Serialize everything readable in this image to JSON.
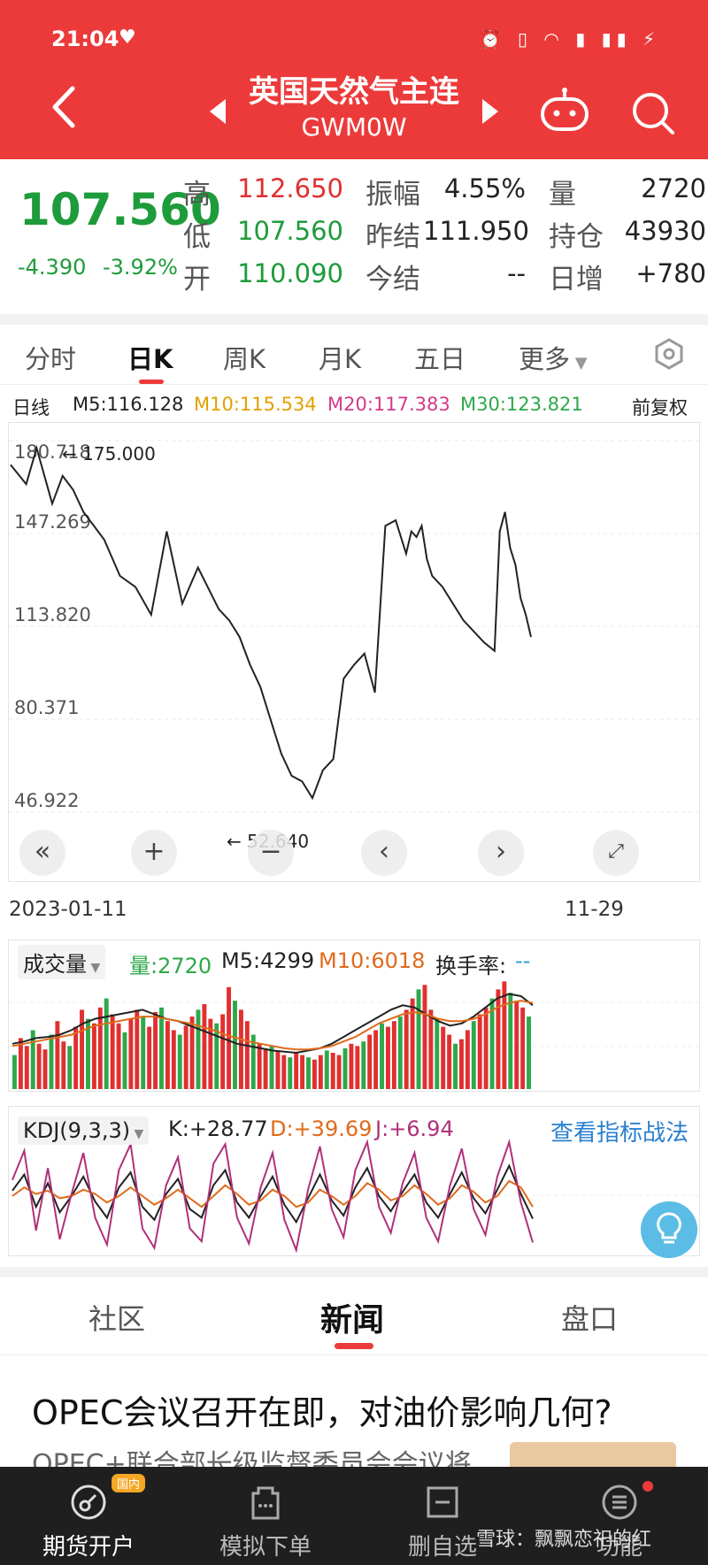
{
  "status_bar": {
    "time": "21:04"
  },
  "header": {
    "title": "英国天然气主连",
    "code": "GWM0W"
  },
  "quote": {
    "last_price": "107.560",
    "change": "-4.390",
    "change_pct": "-3.92%",
    "high_label": "高",
    "high": "112.650",
    "low_label": "低",
    "low": "107.560",
    "open_label": "开",
    "open": "110.090",
    "amplitude_label": "振幅",
    "amplitude": "4.55%",
    "prev_settle_label": "昨结",
    "prev_settle": "111.950",
    "settle_label": "今结",
    "settle": "--",
    "volume_label": "量",
    "volume": "2720",
    "open_interest_label": "持仓",
    "open_interest": "43930",
    "daily_change_label": "日增",
    "daily_change": "+780",
    "colors": {
      "up": "#e03030",
      "down": "#1e9b3a"
    }
  },
  "tabs": [
    {
      "label": "分时"
    },
    {
      "label": "日K"
    },
    {
      "label": "周K"
    },
    {
      "label": "月K"
    },
    {
      "label": "五日"
    },
    {
      "label": "更多"
    }
  ],
  "ma_row": {
    "period": "日线",
    "m5": "M5:116.128",
    "m10": "M10:115.534",
    "m20": "M20:117.383",
    "m30": "M30:123.821",
    "adjust": "前复权"
  },
  "chart_data": [
    {
      "type": "line",
      "y_ticks": [
        "180.718",
        "147.269",
        "113.820",
        "80.371",
        "46.922"
      ],
      "ylim": [
        46.922,
        180.718
      ],
      "annotations": {
        "max_marker": "175.000",
        "min_marker": "52.640"
      },
      "x_labels": {
        "start": "2023-01-11",
        "end": "11-29"
      },
      "x": [
        0,
        3,
        5,
        8,
        10,
        12,
        14,
        16,
        18,
        21,
        24,
        27,
        30,
        33,
        36,
        40,
        42,
        44,
        46,
        48,
        50,
        52,
        54,
        56,
        58,
        60,
        62,
        64,
        66,
        68,
        70,
        72,
        74,
        76,
        77,
        78,
        79,
        80,
        81,
        83,
        85,
        87,
        89,
        91,
        93,
        94,
        95,
        96,
        97,
        98,
        99,
        100
      ],
      "values": [
        172,
        165,
        178,
        158,
        168,
        163,
        155,
        150,
        145,
        132,
        128,
        118,
        148,
        122,
        135,
        120,
        116,
        110,
        100,
        92,
        80,
        68,
        60,
        58,
        52,
        62,
        66,
        95,
        100,
        104,
        90,
        150,
        152,
        140,
        148,
        146,
        150,
        138,
        132,
        128,
        122,
        116,
        112,
        108,
        105,
        148,
        155,
        142,
        136,
        124,
        118,
        110
      ]
    },
    {
      "type": "bar",
      "title": "成交量",
      "volume_label": "量:2720",
      "m5_label": "M5:4299",
      "m10_label": "M10:6018",
      "turnover_label": "换手率:",
      "turnover_value": "--",
      "values": [
        30,
        45,
        38,
        52,
        40,
        35,
        48,
        60,
        42,
        38,
        55,
        70,
        62,
        58,
        72,
        80,
        66,
        58,
        50,
        62,
        70,
        64,
        55,
        68,
        72,
        60,
        52,
        48,
        56,
        64,
        70,
        75,
        62,
        58,
        66,
        90,
        78,
        70,
        60,
        48,
        40,
        36,
        38,
        34,
        30,
        28,
        32,
        30,
        28,
        26,
        30,
        34,
        32,
        30,
        36,
        40,
        38,
        42,
        48,
        52,
        58,
        55,
        60,
        64,
        70,
        80,
        88,
        92,
        70,
        62,
        55,
        48,
        40,
        44,
        52,
        60,
        66,
        72,
        80,
        88,
        95,
        85,
        78,
        72,
        64
      ],
      "m5": [
        40,
        42,
        45,
        46,
        48,
        52,
        58,
        62,
        64,
        66,
        68,
        70,
        66,
        62,
        60,
        56,
        52,
        48,
        44,
        40,
        38,
        36,
        34,
        33,
        32,
        34,
        36,
        40,
        46,
        52,
        58,
        64,
        70,
        74,
        72,
        66,
        60,
        56,
        58,
        64,
        72,
        80,
        84,
        82,
        74
      ],
      "m10": [
        38,
        40,
        42,
        44,
        46,
        48,
        52,
        56,
        58,
        60,
        62,
        64,
        64,
        62,
        60,
        58,
        55,
        52,
        48,
        45,
        42,
        40,
        38,
        36,
        35,
        35,
        36,
        38,
        42,
        46,
        52,
        58,
        62,
        66,
        68,
        66,
        62,
        60,
        60,
        62,
        66,
        72,
        76,
        78,
        76
      ]
    },
    {
      "type": "line",
      "title": "KDJ(9,3,3)",
      "k_label": "K:+28.77",
      "d_label": "D:+39.69",
      "j_label": "J:+6.94",
      "series": [
        {
          "name": "K",
          "values": [
            55,
            70,
            40,
            62,
            35,
            50,
            68,
            45,
            30,
            58,
            72,
            40,
            28,
            52,
            66,
            38,
            30,
            60,
            74,
            44,
            30,
            50,
            68,
            42,
            26,
            48,
            70,
            46,
            32,
            58,
            76,
            50,
            36,
            54,
            70,
            44,
            30,
            52,
            72,
            48,
            34,
            56,
            78,
            52,
            29
          ]
        },
        {
          "name": "D",
          "values": [
            50,
            58,
            52,
            55,
            48,
            50,
            56,
            52,
            44,
            50,
            58,
            50,
            42,
            48,
            56,
            48,
            40,
            50,
            60,
            52,
            42,
            46,
            56,
            50,
            40,
            44,
            56,
            50,
            42,
            50,
            62,
            56,
            46,
            50,
            60,
            52,
            42,
            48,
            60,
            54,
            44,
            50,
            64,
            58,
            40
          ]
        },
        {
          "name": "J",
          "values": [
            65,
            92,
            18,
            76,
            10,
            52,
            90,
            30,
            5,
            74,
            98,
            20,
            2,
            60,
            86,
            20,
            8,
            80,
            98,
            30,
            6,
            58,
            90,
            28,
            0,
            56,
            96,
            38,
            12,
            74,
            100,
            40,
            16,
            62,
            90,
            30,
            8,
            60,
            94,
            38,
            14,
            68,
            100,
            44,
            7
          ]
        }
      ]
    }
  ],
  "indicator": {
    "strategy_link": "查看指标战法"
  },
  "news_tabs": [
    {
      "label": "社区"
    },
    {
      "label": "新闻"
    },
    {
      "label": "盘口"
    }
  ],
  "news": {
    "title": "OPEC会议召开在即，对油价影响几何?",
    "snippet": "OPEC+联合部长级监督委员会会议将"
  },
  "bottom_nav": [
    {
      "label": "期货开户",
      "badge": "国内",
      "icon": "account-icon"
    },
    {
      "label": "模拟下单",
      "icon": "simulate-icon"
    },
    {
      "label": "删自选",
      "icon": "remove-watch-icon"
    },
    {
      "label": "功能",
      "icon": "menu-icon"
    }
  ],
  "watermark": "雪球：飘飘恋祀的红"
}
